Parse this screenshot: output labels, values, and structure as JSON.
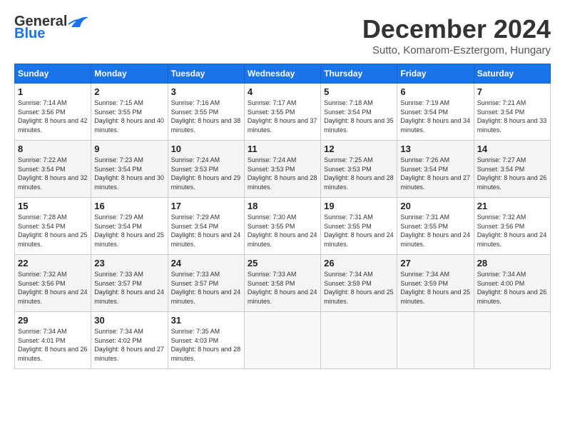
{
  "header": {
    "logo_line1": "General",
    "logo_line2": "Blue",
    "month": "December 2024",
    "location": "Sutto, Komarom-Esztergom, Hungary"
  },
  "days_of_week": [
    "Sunday",
    "Monday",
    "Tuesday",
    "Wednesday",
    "Thursday",
    "Friday",
    "Saturday"
  ],
  "weeks": [
    [
      {
        "day": "1",
        "sunrise": "Sunrise: 7:14 AM",
        "sunset": "Sunset: 3:56 PM",
        "daylight": "Daylight: 8 hours and 42 minutes."
      },
      {
        "day": "2",
        "sunrise": "Sunrise: 7:15 AM",
        "sunset": "Sunset: 3:55 PM",
        "daylight": "Daylight: 8 hours and 40 minutes."
      },
      {
        "day": "3",
        "sunrise": "Sunrise: 7:16 AM",
        "sunset": "Sunset: 3:55 PM",
        "daylight": "Daylight: 8 hours and 38 minutes."
      },
      {
        "day": "4",
        "sunrise": "Sunrise: 7:17 AM",
        "sunset": "Sunset: 3:55 PM",
        "daylight": "Daylight: 8 hours and 37 minutes."
      },
      {
        "day": "5",
        "sunrise": "Sunrise: 7:18 AM",
        "sunset": "Sunset: 3:54 PM",
        "daylight": "Daylight: 8 hours and 35 minutes."
      },
      {
        "day": "6",
        "sunrise": "Sunrise: 7:19 AM",
        "sunset": "Sunset: 3:54 PM",
        "daylight": "Daylight: 8 hours and 34 minutes."
      },
      {
        "day": "7",
        "sunrise": "Sunrise: 7:21 AM",
        "sunset": "Sunset: 3:54 PM",
        "daylight": "Daylight: 8 hours and 33 minutes."
      }
    ],
    [
      {
        "day": "8",
        "sunrise": "Sunrise: 7:22 AM",
        "sunset": "Sunset: 3:54 PM",
        "daylight": "Daylight: 8 hours and 32 minutes."
      },
      {
        "day": "9",
        "sunrise": "Sunrise: 7:23 AM",
        "sunset": "Sunset: 3:54 PM",
        "daylight": "Daylight: 8 hours and 30 minutes."
      },
      {
        "day": "10",
        "sunrise": "Sunrise: 7:24 AM",
        "sunset": "Sunset: 3:53 PM",
        "daylight": "Daylight: 8 hours and 29 minutes."
      },
      {
        "day": "11",
        "sunrise": "Sunrise: 7:24 AM",
        "sunset": "Sunset: 3:53 PM",
        "daylight": "Daylight: 8 hours and 28 minutes."
      },
      {
        "day": "12",
        "sunrise": "Sunrise: 7:25 AM",
        "sunset": "Sunset: 3:53 PM",
        "daylight": "Daylight: 8 hours and 28 minutes."
      },
      {
        "day": "13",
        "sunrise": "Sunrise: 7:26 AM",
        "sunset": "Sunset: 3:54 PM",
        "daylight": "Daylight: 8 hours and 27 minutes."
      },
      {
        "day": "14",
        "sunrise": "Sunrise: 7:27 AM",
        "sunset": "Sunset: 3:54 PM",
        "daylight": "Daylight: 8 hours and 26 minutes."
      }
    ],
    [
      {
        "day": "15",
        "sunrise": "Sunrise: 7:28 AM",
        "sunset": "Sunset: 3:54 PM",
        "daylight": "Daylight: 8 hours and 25 minutes."
      },
      {
        "day": "16",
        "sunrise": "Sunrise: 7:29 AM",
        "sunset": "Sunset: 3:54 PM",
        "daylight": "Daylight: 8 hours and 25 minutes."
      },
      {
        "day": "17",
        "sunrise": "Sunrise: 7:29 AM",
        "sunset": "Sunset: 3:54 PM",
        "daylight": "Daylight: 8 hours and 24 minutes."
      },
      {
        "day": "18",
        "sunrise": "Sunrise: 7:30 AM",
        "sunset": "Sunset: 3:55 PM",
        "daylight": "Daylight: 8 hours and 24 minutes."
      },
      {
        "day": "19",
        "sunrise": "Sunrise: 7:31 AM",
        "sunset": "Sunset: 3:55 PM",
        "daylight": "Daylight: 8 hours and 24 minutes."
      },
      {
        "day": "20",
        "sunrise": "Sunrise: 7:31 AM",
        "sunset": "Sunset: 3:55 PM",
        "daylight": "Daylight: 8 hours and 24 minutes."
      },
      {
        "day": "21",
        "sunrise": "Sunrise: 7:32 AM",
        "sunset": "Sunset: 3:56 PM",
        "daylight": "Daylight: 8 hours and 24 minutes."
      }
    ],
    [
      {
        "day": "22",
        "sunrise": "Sunrise: 7:32 AM",
        "sunset": "Sunset: 3:56 PM",
        "daylight": "Daylight: 8 hours and 24 minutes."
      },
      {
        "day": "23",
        "sunrise": "Sunrise: 7:33 AM",
        "sunset": "Sunset: 3:57 PM",
        "daylight": "Daylight: 8 hours and 24 minutes."
      },
      {
        "day": "24",
        "sunrise": "Sunrise: 7:33 AM",
        "sunset": "Sunset: 3:57 PM",
        "daylight": "Daylight: 8 hours and 24 minutes."
      },
      {
        "day": "25",
        "sunrise": "Sunrise: 7:33 AM",
        "sunset": "Sunset: 3:58 PM",
        "daylight": "Daylight: 8 hours and 24 minutes."
      },
      {
        "day": "26",
        "sunrise": "Sunrise: 7:34 AM",
        "sunset": "Sunset: 3:59 PM",
        "daylight": "Daylight: 8 hours and 25 minutes."
      },
      {
        "day": "27",
        "sunrise": "Sunrise: 7:34 AM",
        "sunset": "Sunset: 3:59 PM",
        "daylight": "Daylight: 8 hours and 25 minutes."
      },
      {
        "day": "28",
        "sunrise": "Sunrise: 7:34 AM",
        "sunset": "Sunset: 4:00 PM",
        "daylight": "Daylight: 8 hours and 26 minutes."
      }
    ],
    [
      {
        "day": "29",
        "sunrise": "Sunrise: 7:34 AM",
        "sunset": "Sunset: 4:01 PM",
        "daylight": "Daylight: 8 hours and 26 minutes."
      },
      {
        "day": "30",
        "sunrise": "Sunrise: 7:34 AM",
        "sunset": "Sunset: 4:02 PM",
        "daylight": "Daylight: 8 hours and 27 minutes."
      },
      {
        "day": "31",
        "sunrise": "Sunrise: 7:35 AM",
        "sunset": "Sunset: 4:03 PM",
        "daylight": "Daylight: 8 hours and 28 minutes."
      },
      null,
      null,
      null,
      null
    ]
  ]
}
